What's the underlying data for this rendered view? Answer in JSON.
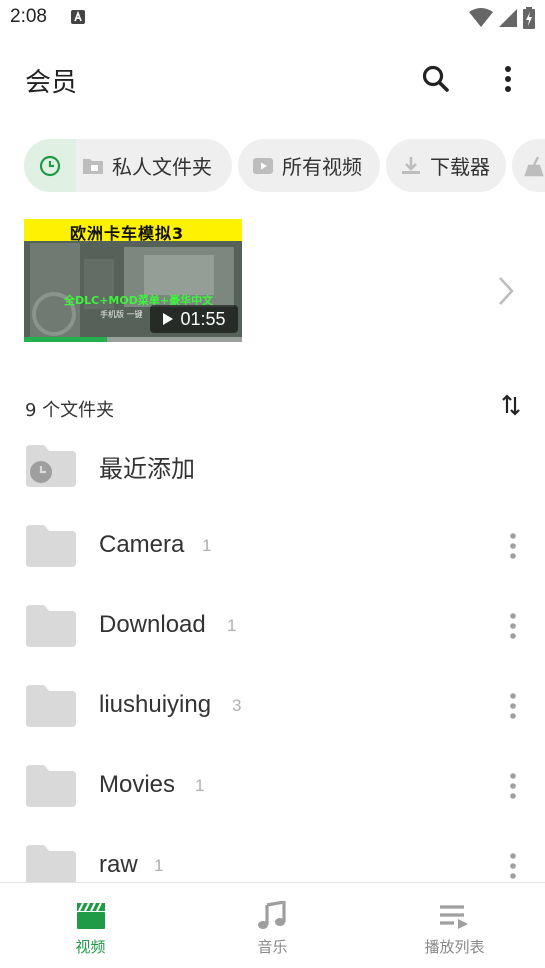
{
  "status_bar": {
    "time": "2:08"
  },
  "app_bar": {
    "title": "会员",
    "search_icon": "search-icon",
    "more_icon": "more-vert-icon"
  },
  "chips": [
    {
      "label": "私人文件夹",
      "icon": "lock-folder-icon"
    },
    {
      "label": "所有视频",
      "icon": "video-icon"
    },
    {
      "label": "下载器",
      "icon": "download-icon"
    }
  ],
  "recent_video": {
    "title_banner": "欧洲卡车模拟3",
    "overlay_text": "全DLC+MOD菜单+豪华中文",
    "small_text": "手机版 一键",
    "duration": "01:55",
    "progress_fraction": 0.38
  },
  "folders_header": {
    "count_label": "9 个文件夹"
  },
  "folders": [
    {
      "name": "最近添加",
      "count": ""
    },
    {
      "name": "Camera",
      "count": "1"
    },
    {
      "name": "Download",
      "count": "1"
    },
    {
      "name": "liushuiying",
      "count": "3"
    },
    {
      "name": "Movies",
      "count": "1"
    },
    {
      "name": "raw",
      "count": "1"
    }
  ],
  "bottom_nav": [
    {
      "label": "视频",
      "icon": "clapperboard-icon",
      "active": true
    },
    {
      "label": "音乐",
      "icon": "music-note-icon",
      "active": false
    },
    {
      "label": "播放列表",
      "icon": "playlist-icon",
      "active": false
    }
  ],
  "colors": {
    "accent": "#1f9a47",
    "chip_bg": "#efefef",
    "recent_chip_bg": "#e0f1e3",
    "folder_icon": "#d9d9d9"
  }
}
